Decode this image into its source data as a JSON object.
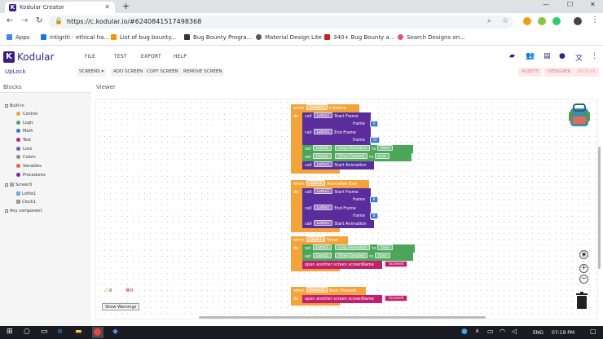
{
  "browser": {
    "tab_title": "Kodular Creator",
    "tab_icon": "K",
    "new_tab": "+",
    "url": "https://c.kodular.io/#6240841517498368",
    "bookmarks": [
      {
        "label": "Apps",
        "color": "#4285f4"
      },
      {
        "label": "intigriti - ethical ha...",
        "color": "#1a73e8"
      },
      {
        "label": "List of bug bounty...",
        "color": "#f29900"
      },
      {
        "label": "Bug Bounty Progra...",
        "color": "#333333"
      },
      {
        "label": "Material Design Lite",
        "color": "#555555"
      },
      {
        "label": "340+ Bug Bounty a...",
        "color": "#c5221f"
      },
      {
        "label": "Search Designs on...",
        "color": "#ea4c89"
      }
    ]
  },
  "app": {
    "logo_letter": "K",
    "name": "Kodular",
    "menu": [
      "FILE",
      "TEST",
      "EXPORT",
      "HELP"
    ],
    "project": "UpLock",
    "screen_btn": "SCREENS ▾",
    "add_screen": "ADD SCREEN",
    "copy_screen": "COPY SCREEN",
    "remove_screen": "REMOVE SCREEN",
    "assets": "ASSETS",
    "designer": "DESIGNER",
    "blocks": "BLOCKS"
  },
  "panels": {
    "blocks_title": "Blocks",
    "viewer_title": "Viewer"
  },
  "tree": {
    "builtin": "Built-in",
    "items": [
      {
        "label": "Control",
        "color": "#f2a33a"
      },
      {
        "label": "Logic",
        "color": "#4ca65a"
      },
      {
        "label": "Math",
        "color": "#3a78c9"
      },
      {
        "label": "Text",
        "color": "#c41f6e"
      },
      {
        "label": "Lists",
        "color": "#7a4fb5"
      },
      {
        "label": "Colors",
        "color": "#8a8a8a"
      },
      {
        "label": "Variables",
        "color": "#e8643b"
      },
      {
        "label": "Procedures",
        "color": "#7a2b9c"
      }
    ],
    "screen": "Screen5",
    "components": [
      "Lottie1",
      "Clock1"
    ],
    "any": "Any component"
  },
  "blocks": {
    "b1": {
      "when": "when",
      "comp": "Screen5",
      "event": "Initialize",
      "do": "do",
      "call": "call",
      "lottie": "Lottie1",
      "start_frame": "Start Frame",
      "frame": "frame",
      "v1": "0",
      "end_frame": "End Frame",
      "v2": "50",
      "set": "set",
      "to": "to",
      "loop": "Loop Animation",
      "false": "false",
      "clock": "Clock1",
      "timer": "Timer Enabled",
      "true": "true",
      "start_anim": "Start Animation"
    },
    "b2": {
      "when": "when",
      "comp": "Lottie1",
      "event": "Animation End",
      "do": "do",
      "call": "call",
      "lottie": "Lottie1",
      "start_frame": "Start Frame",
      "frame": "frame",
      "v1": "8",
      "end_frame": "End Frame",
      "v2": "8",
      "start_anim": "Start Animation"
    },
    "b3": {
      "when": "when",
      "comp": "Clock1",
      "event": "Timer",
      "do": "do",
      "set": "set",
      "to": "to",
      "lottie": "Lottie1",
      "loop": "Loop Animation",
      "false": "false",
      "clock": "Clock1",
      "timer": "Timer Enabled",
      "open": "open another screen  screenName",
      "screen": "Screen6"
    },
    "b4": {
      "when": "when",
      "comp": "Screen5",
      "event": "Back Pressed",
      "do": "do",
      "open": "open another screen  screenName",
      "screen": "Screen6"
    }
  },
  "warnings": {
    "warn_count": "0",
    "err_count": "0",
    "show_btn": "Show Warnings"
  },
  "taskbar": {
    "lang": "ENG",
    "time": "07:19 PM"
  }
}
